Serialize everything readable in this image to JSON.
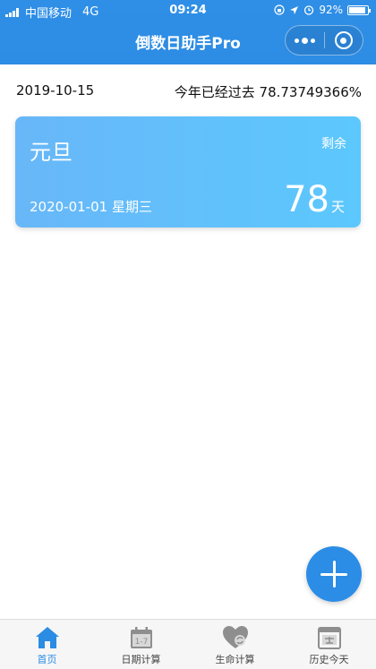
{
  "status_bar": {
    "carrier": "中国移动",
    "network": "4G",
    "time": "09:24",
    "battery": "92%",
    "battery_level": 0.92
  },
  "header": {
    "title": "倒数日助手Pro"
  },
  "info": {
    "today": "2019-10-15",
    "year_progress": "今年已经过去 78.73749366%"
  },
  "events": [
    {
      "name": "元旦",
      "remain_label": "剩余",
      "date": "2020-01-01 星期三",
      "days": "78",
      "unit": "天"
    }
  ],
  "tabs": [
    {
      "label": "首页",
      "icon": "home-icon",
      "active": true
    },
    {
      "label": "日期计算",
      "icon": "calendar-icon",
      "active": false
    },
    {
      "label": "生命计算",
      "icon": "heart-refresh-icon",
      "active": false
    },
    {
      "label": "历史今天",
      "icon": "history-today-icon",
      "active": false
    }
  ],
  "colors": {
    "primary": "#2d8ce3",
    "card_start": "#68b7f8",
    "card_end": "#5cc8fd",
    "tab_active": "#2a8ce3",
    "tab_inactive": "#8e8e8e"
  }
}
